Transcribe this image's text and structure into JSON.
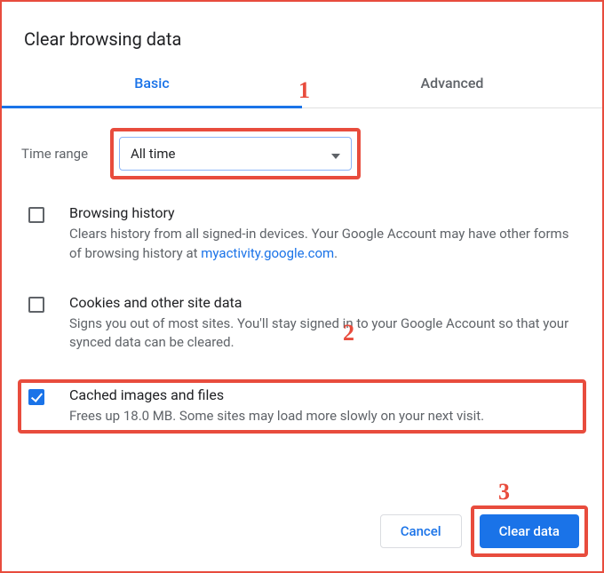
{
  "title": "Clear browsing data",
  "tabs": {
    "basic": "Basic",
    "advanced": "Advanced"
  },
  "timeRange": {
    "label": "Time range",
    "value": "All time"
  },
  "options": {
    "browsingHistory": {
      "title": "Browsing history",
      "desc_before": "Clears history from all signed-in devices. Your Google Account may have other forms of browsing history at ",
      "link_text": "myactivity.google.com",
      "desc_after": ".",
      "checked": false
    },
    "cookies": {
      "title": "Cookies and other site data",
      "desc": "Signs you out of most sites. You'll stay signed in to your Google Account so that your synced data can be cleared.",
      "checked": false
    },
    "cached": {
      "title": "Cached images and files",
      "desc": "Frees up 18.0 MB. Some sites may load more slowly on your next visit.",
      "checked": true
    }
  },
  "buttons": {
    "cancel": "Cancel",
    "clear": "Clear data"
  },
  "annotations": {
    "one": "1",
    "two": "2",
    "three": "3"
  }
}
